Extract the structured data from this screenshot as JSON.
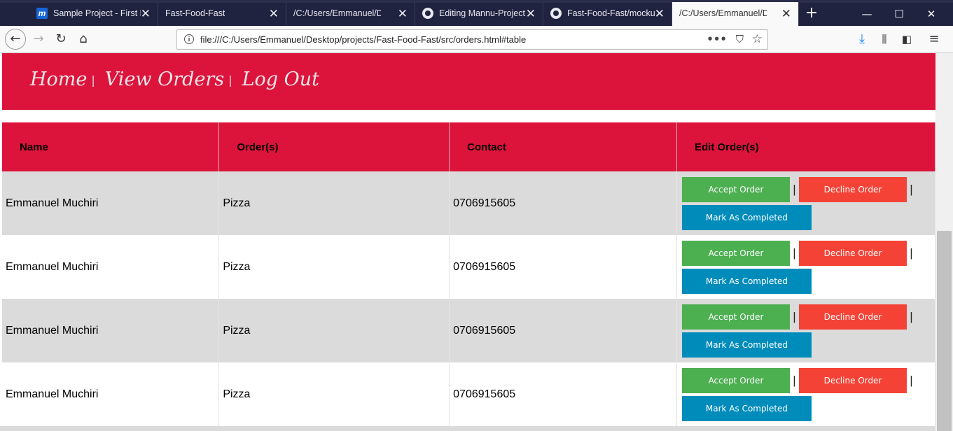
{
  "tabs": [
    {
      "label": "Sample Project - First P",
      "favicon": "m-logo-icon"
    },
    {
      "label": "Fast-Food-Fast",
      "favicon": ""
    },
    {
      "label": "/C:/Users/Emmanuel/Deskt",
      "favicon": ""
    },
    {
      "label": "Editing Mannu-Project",
      "favicon": "github-icon"
    },
    {
      "label": "Fast-Food-Fast/mockup",
      "favicon": "github-icon"
    },
    {
      "label": "/C:/Users/Emmanuel/Deskt",
      "favicon": "",
      "active": true
    }
  ],
  "address_bar": {
    "url": "file:///C:/Users/Emmanuel/Desktop/projects/Fast-Food-Fast/src/orders.html#table"
  },
  "site_nav": {
    "home": "Home",
    "view_orders": "View Orders",
    "log_out": "Log Out",
    "separator": "|"
  },
  "table": {
    "headers": [
      "Name",
      "Order(s)",
      "Contact",
      "Edit Order(s)"
    ],
    "rows": [
      {
        "name": "Emmanuel Muchiri",
        "order": "Pizza",
        "contact": "0706915605"
      },
      {
        "name": "Emmanuel Muchiri",
        "order": "Pizza",
        "contact": "0706915605"
      },
      {
        "name": "Emmanuel Muchiri",
        "order": "Pizza",
        "contact": "0706915605"
      },
      {
        "name": "Emmanuel Muchiri",
        "order": "Pizza",
        "contact": "0706915605"
      }
    ],
    "actions": {
      "accept": "Accept Order",
      "decline": "Decline Order",
      "complete": "Mark As Completed",
      "separator": "|"
    }
  },
  "colors": {
    "brand": "#dc143c",
    "accept": "#4caf50",
    "decline": "#f44336",
    "complete": "#008cba"
  }
}
